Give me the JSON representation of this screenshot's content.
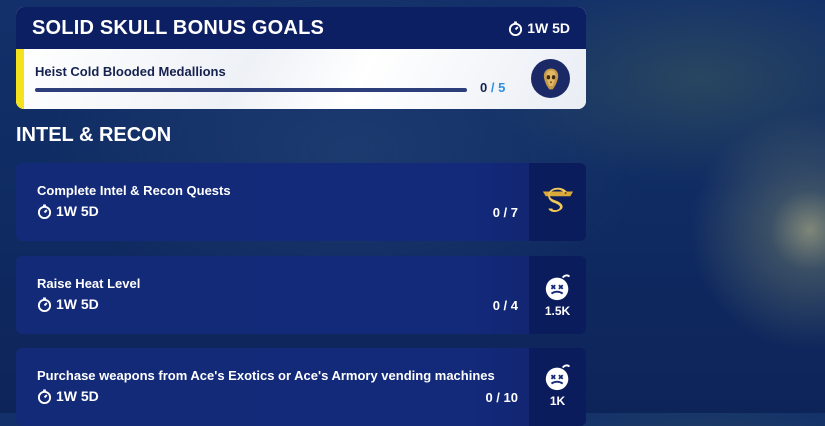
{
  "bonus": {
    "title": "SOLID SKULL BONUS GOALS",
    "timer": "1W 5D",
    "quest": {
      "title": "Heist Cold Blooded Medallions",
      "progress_current": "0",
      "progress_sep": " / ",
      "progress_total": "5",
      "progress_fraction": 0,
      "reward_icon": "skull-medallion-icon"
    }
  },
  "section": {
    "title": "INTEL & RECON"
  },
  "quests": [
    {
      "title": "Complete Intel & Recon Quests",
      "timer": "1W 5D",
      "count": "0 / 7",
      "reward_icon": "snake-emblem-icon",
      "reward_value": ""
    },
    {
      "title": "Raise Heat Level",
      "timer": "1W 5D",
      "count": "0 / 4",
      "reward_icon": "xp-bomb-icon",
      "reward_value": "1.5K"
    },
    {
      "title": "Purchase weapons from Ace's Exotics or Ace's Armory vending machines",
      "timer": "1W 5D",
      "count": "0 / 10",
      "reward_icon": "xp-bomb-icon",
      "reward_value": "1K"
    }
  ],
  "colors": {
    "header": "#0d1f63",
    "accent": "#f4e21c",
    "card": "#13297a",
    "progress_sep": "#2f8fe0"
  }
}
